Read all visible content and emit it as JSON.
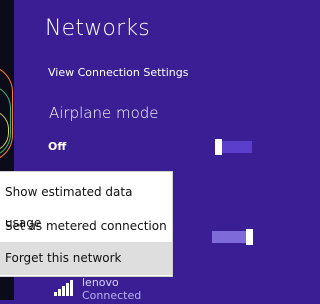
{
  "panel": {
    "title": "Networks",
    "view_connection_settings": "View Connection Settings",
    "airplane_mode_label": "Airplane mode",
    "airplane_mode_state": "Off"
  },
  "network": {
    "name": "lenovo",
    "status": "Connected"
  },
  "context_menu": {
    "items": [
      {
        "label": "Show estimated data usage"
      },
      {
        "label": "Set as metered connection"
      },
      {
        "label": "Forget this network"
      }
    ]
  },
  "colors": {
    "charm_background": "#3a1f94",
    "menu_background": "#ffffff",
    "menu_hover": "#dedede",
    "toggle_knob": "#ffffff"
  },
  "icons": {
    "signal": "wifi-signal-icon"
  }
}
